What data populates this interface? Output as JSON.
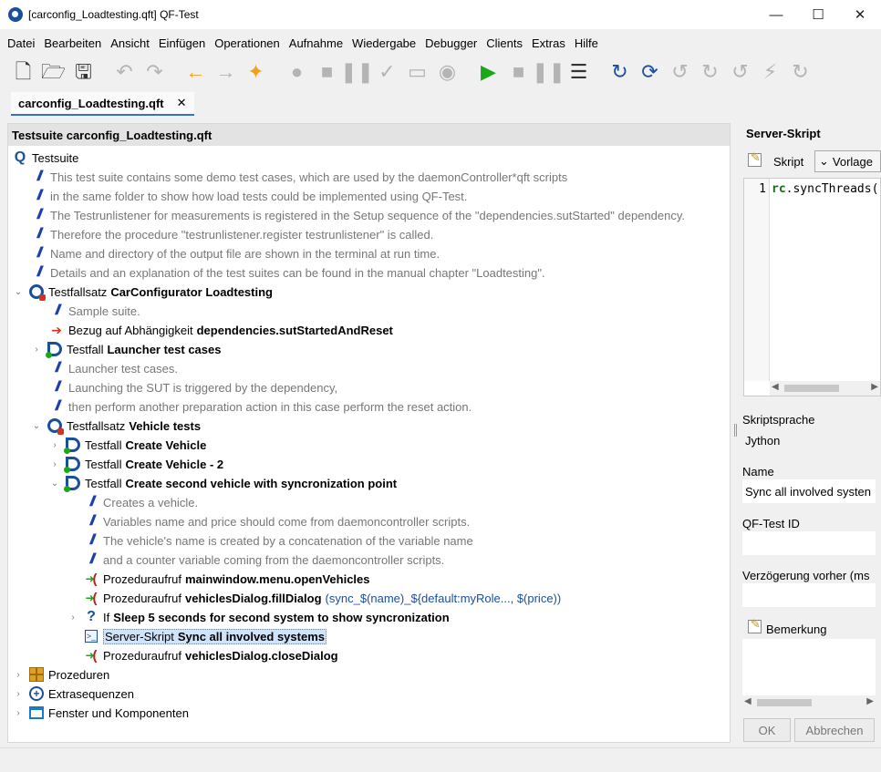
{
  "window": {
    "title": "[carconfig_Loadtesting.qft] QF-Test"
  },
  "menu": [
    "Datei",
    "Bearbeiten",
    "Ansicht",
    "Einfügen",
    "Operationen",
    "Aufnahme",
    "Wiedergabe",
    "Debugger",
    "Clients",
    "Extras",
    "Hilfe"
  ],
  "tab": {
    "label": "carconfig_Loadtesting.qft"
  },
  "tree": {
    "header": "Testsuite carconfig_Loadtesting.qft",
    "rows": [
      {
        "type": "Testsuite",
        "name": ""
      },
      {
        "text": "This test suite contains some demo test cases, which are used by the daemonController*qft scripts"
      },
      {
        "text": " in the same folder to show how load tests could be implemented using QF-Test."
      },
      {
        "text": "The Testrunlistener for measurements is registered in the Setup sequence of the \"dependencies.sutStarted\" dependency."
      },
      {
        "text": "Therefore the procedure \"testrunlistener.register testrunlistener\" is called."
      },
      {
        "text": "Name and directory of the output file are shown in the terminal at run time."
      },
      {
        "text": " Details and an explanation of the test suites can be found in the manual chapter \"Loadtesting\"."
      },
      {
        "type": "Testfallsatz",
        "name": "CarConfigurator Loadtesting"
      },
      {
        "text": "Sample suite."
      },
      {
        "type": "Bezug auf Abhängigkeit",
        "name": "dependencies.sutStartedAndReset"
      },
      {
        "type": "Testfall",
        "name": "Launcher test cases"
      },
      {
        "text": "Launcher test cases."
      },
      {
        "text": "Launching the SUT is triggered by the dependency,"
      },
      {
        "text": "then perform another preparation action in this case perform the reset action."
      },
      {
        "type": "Testfallsatz",
        "name": "Vehicle tests"
      },
      {
        "type": "Testfall",
        "name": "Create Vehicle"
      },
      {
        "type": "Testfall",
        "name": "Create Vehicle - 2"
      },
      {
        "type": "Testfall",
        "name": "Create second vehicle with syncronization point"
      },
      {
        "text": "Creates a vehicle."
      },
      {
        "text": "Variables name and price should come from daemoncontroller scripts."
      },
      {
        "text": "The vehicle's name is created by a concatenation of the variable name"
      },
      {
        "text": " and a counter variable coming from the daemoncontroller scripts."
      },
      {
        "type": "Prozeduraufruf",
        "name": "mainwindow.menu.openVehicles"
      },
      {
        "type": "Prozeduraufruf",
        "name": "vehiclesDialog.fillDialog",
        "params": "(sync_$(name)_${default:myRole..., $(price))"
      },
      {
        "type": "If",
        "name": "Sleep 5 seconds for second system to show syncronization"
      },
      {
        "type": "Server-Skript",
        "name": "Sync all involved systems"
      },
      {
        "type": "Prozeduraufruf",
        "name": "vehiclesDialog.closeDialog"
      },
      {
        "type": "Prozeduren",
        "name": ""
      },
      {
        "type": "Extrasequenzen",
        "name": ""
      },
      {
        "type": "Fenster und Komponenten",
        "name": ""
      }
    ]
  },
  "details": {
    "title": "Server-Skript",
    "script_label": "Skript",
    "template_label": "Vorlage",
    "line_number": "1",
    "code_kw": "rc",
    "code_rest": ".syncThreads(",
    "language_label": "Skriptsprache",
    "language_value": "Jython",
    "name_label": "Name",
    "name_value": "Sync all involved systen",
    "id_label": "QF-Test ID",
    "id_value": "",
    "delay_label": "Verzögerung vorher (ms",
    "delay_value": "",
    "comment_label": "Bemerkung",
    "ok_label": "OK",
    "cancel_label": "Abbrechen"
  }
}
